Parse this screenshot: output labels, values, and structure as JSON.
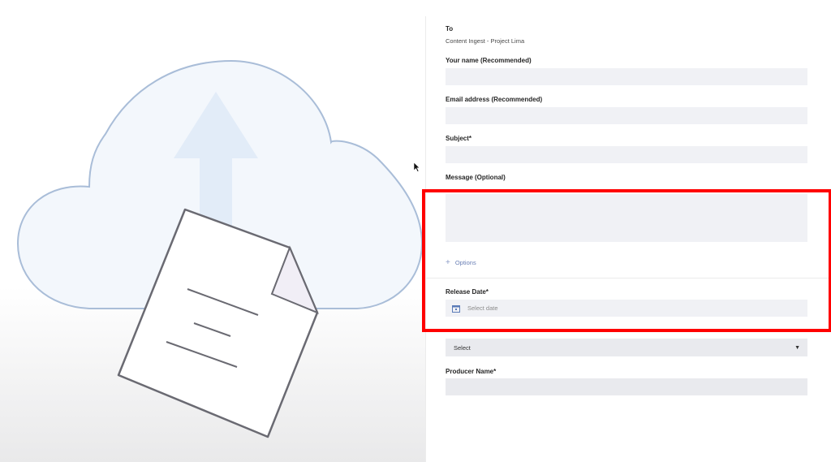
{
  "illustration": {
    "name": "cloud-upload-illustration"
  },
  "form": {
    "to_label": "To",
    "to_value": "Content Ingest - Project Lima",
    "name_label": "Your name (Recommended)",
    "name_value": "",
    "email_label": "Email address (Recommended)",
    "email_value": "",
    "subject_label": "Subject*",
    "subject_value": "",
    "message_label": "Message (Optional)",
    "message_value": "",
    "options_label": "Options",
    "release_date_label": "Release Date*",
    "release_date_placeholder": "Select date",
    "select_value": "Select",
    "producer_label": "Producer Name*",
    "producer_value": ""
  },
  "colors": {
    "highlight": "#ff0000",
    "field_bg": "#f0f1f5",
    "options_link": "#6a7fb5"
  }
}
